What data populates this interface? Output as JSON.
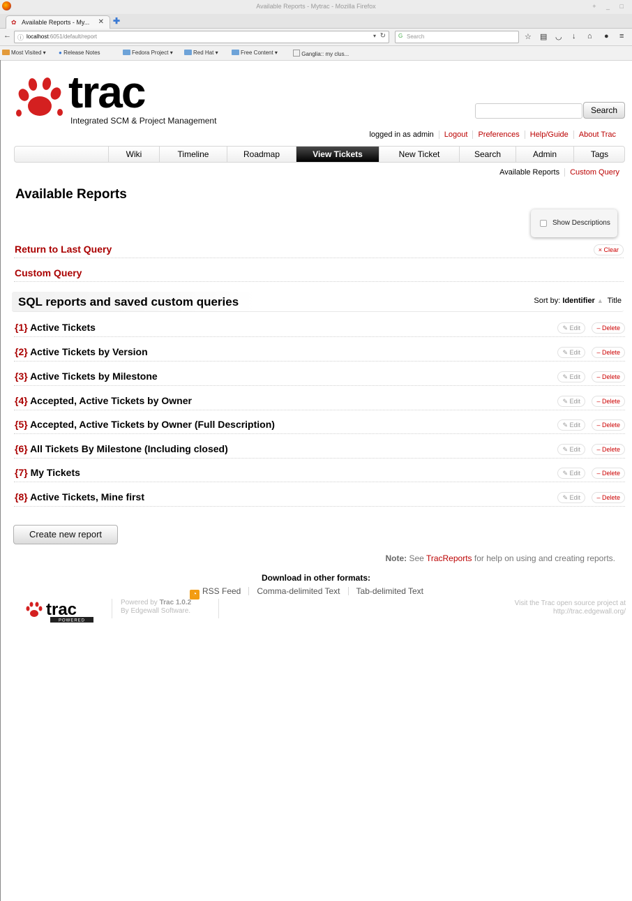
{
  "browser": {
    "window_title": "Available Reports - Mytrac - Mozilla Firefox",
    "tab_label": "Available Reports - My...",
    "url_host": "localhost",
    "url_path": ":6051/default/report",
    "search_placeholder": "Search",
    "bookmarks": [
      "Most Visited",
      "Release Notes",
      "Fedora Project",
      "Red Hat",
      "Free Content",
      "Ganglia:: my clus..."
    ]
  },
  "trac": {
    "logo_text": "trac",
    "logo_subtitle": "Integrated SCM & Project Management",
    "search_button": "Search",
    "metanav": {
      "user": "logged in as admin",
      "logout": "Logout",
      "preferences": "Preferences",
      "help": "Help/Guide",
      "about": "About Trac"
    },
    "mainnav": [
      "Wiki",
      "Timeline",
      "Roadmap",
      "View Tickets",
      "New Ticket",
      "Search",
      "Admin",
      "Tags"
    ],
    "ctxtnav": {
      "current": "Available Reports",
      "custom_query": "Custom Query"
    }
  },
  "page": {
    "title": "Available Reports",
    "show_descriptions": "Show Descriptions",
    "return_last_query": "Return to Last Query",
    "clear": "× Clear",
    "custom_query": "Custom Query",
    "sql_heading": "SQL reports and saved custom queries",
    "sort_by": "Sort by:",
    "sort_identifier": "Identifier",
    "sort_title": "Title",
    "edit_label": "✎ Edit",
    "delete_label": "– Delete",
    "reports": [
      {
        "id": "{1}",
        "title": "Active Tickets"
      },
      {
        "id": "{2}",
        "title": "Active Tickets by Version"
      },
      {
        "id": "{3}",
        "title": "Active Tickets by Milestone"
      },
      {
        "id": "{4}",
        "title": "Accepted, Active Tickets by Owner"
      },
      {
        "id": "{5}",
        "title": "Accepted, Active Tickets by Owner (Full Description)"
      },
      {
        "id": "{6}",
        "title": "All Tickets By Milestone (Including closed)"
      },
      {
        "id": "{7}",
        "title": "My Tickets"
      },
      {
        "id": "{8}",
        "title": "Active Tickets, Mine first"
      }
    ],
    "create_button": "Create new report",
    "note_label": "Note:",
    "note_pre": "See",
    "note_link": "TracReports",
    "note_post": "for help on using and creating reports."
  },
  "footer": {
    "download_heading": "Download in other formats:",
    "rss": "RSS Feed",
    "csv": "Comma-delimited Text",
    "tsv": "Tab-delimited Text",
    "powered_by": "Powered by",
    "trac_version": "Trac 1.0.2",
    "by_line": "By Edgewall Software.",
    "visit_line1": "Visit the Trac open source project at",
    "visit_line2": "http://trac.edgewall.org/",
    "logo_caption": "POWERED"
  },
  "colors": {
    "link_red": "#aa0000",
    "active_nav": "#000000"
  }
}
